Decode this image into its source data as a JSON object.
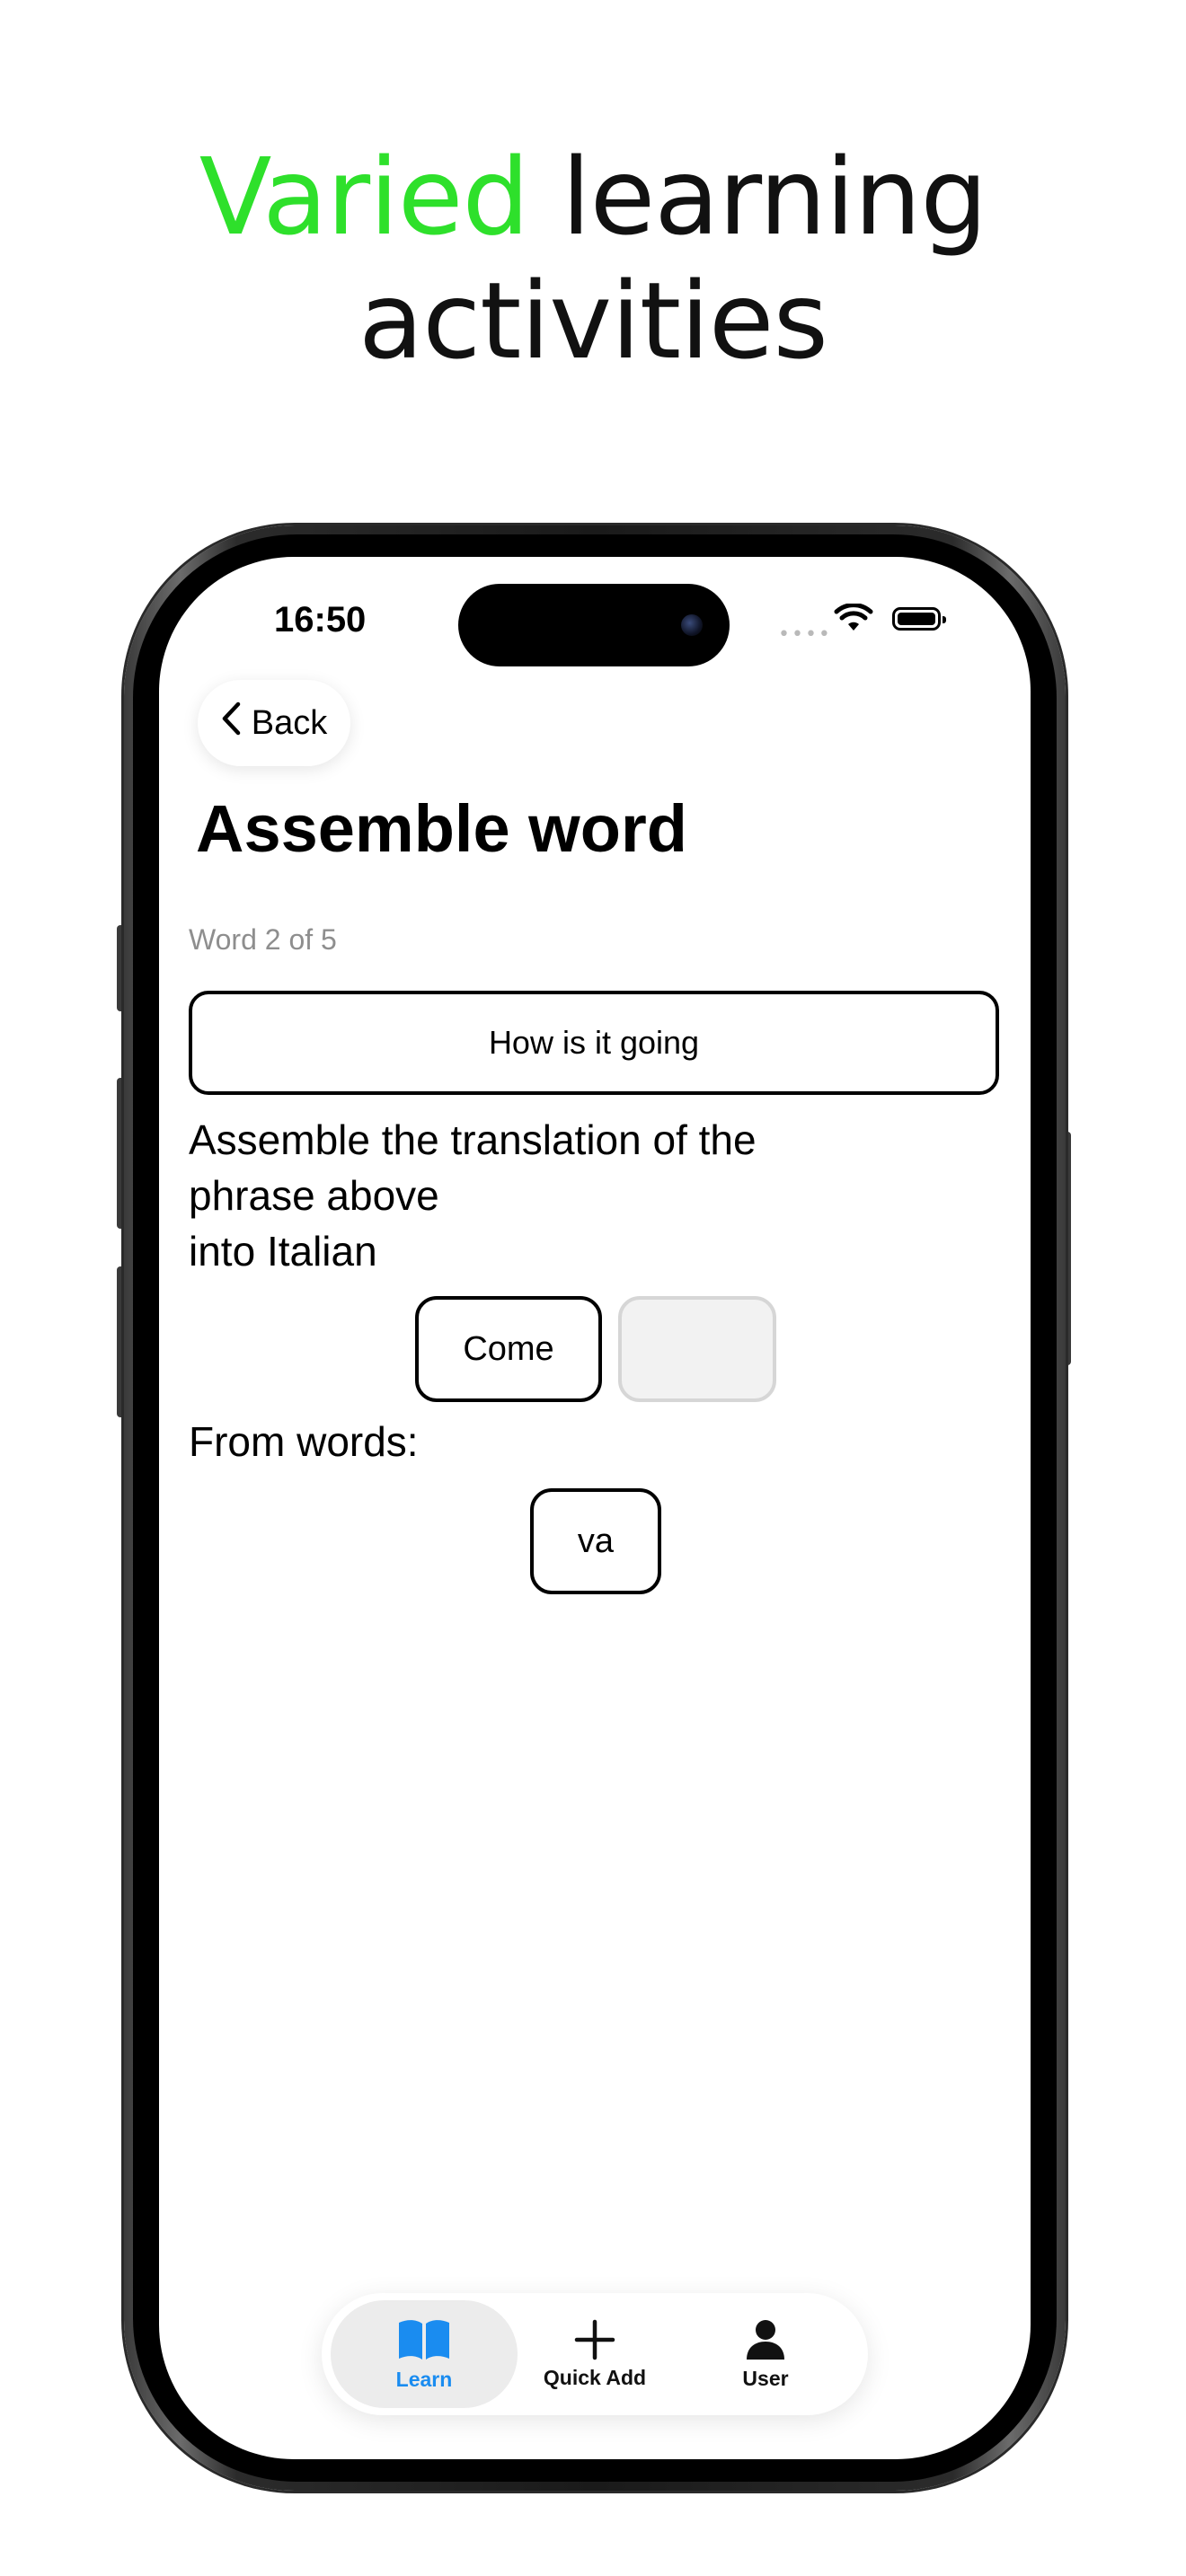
{
  "headline": {
    "accent": "Varied",
    "rest_line1": " learning",
    "line2": "activities"
  },
  "status_bar": {
    "time": "16:50"
  },
  "nav": {
    "back_label": "Back"
  },
  "page": {
    "title": "Assemble word",
    "progress": "Word 2 of 5",
    "source_phrase": "How is it going",
    "instruction_line1": "Assemble the translation of the",
    "instruction_line2": "phrase above",
    "instruction_line3": "into Italian",
    "assembled_words": [
      "Come"
    ],
    "from_words_label": "From words:",
    "available_words": [
      "va"
    ]
  },
  "tab_bar": {
    "tabs": [
      {
        "label": "Learn",
        "icon": "book-icon",
        "active": true
      },
      {
        "label": "Quick Add",
        "icon": "plus-icon",
        "active": false
      },
      {
        "label": "User",
        "icon": "person-icon",
        "active": false
      }
    ]
  },
  "colors": {
    "accent_green": "#2ee02b",
    "active_tab_blue": "#1a8cf0"
  }
}
